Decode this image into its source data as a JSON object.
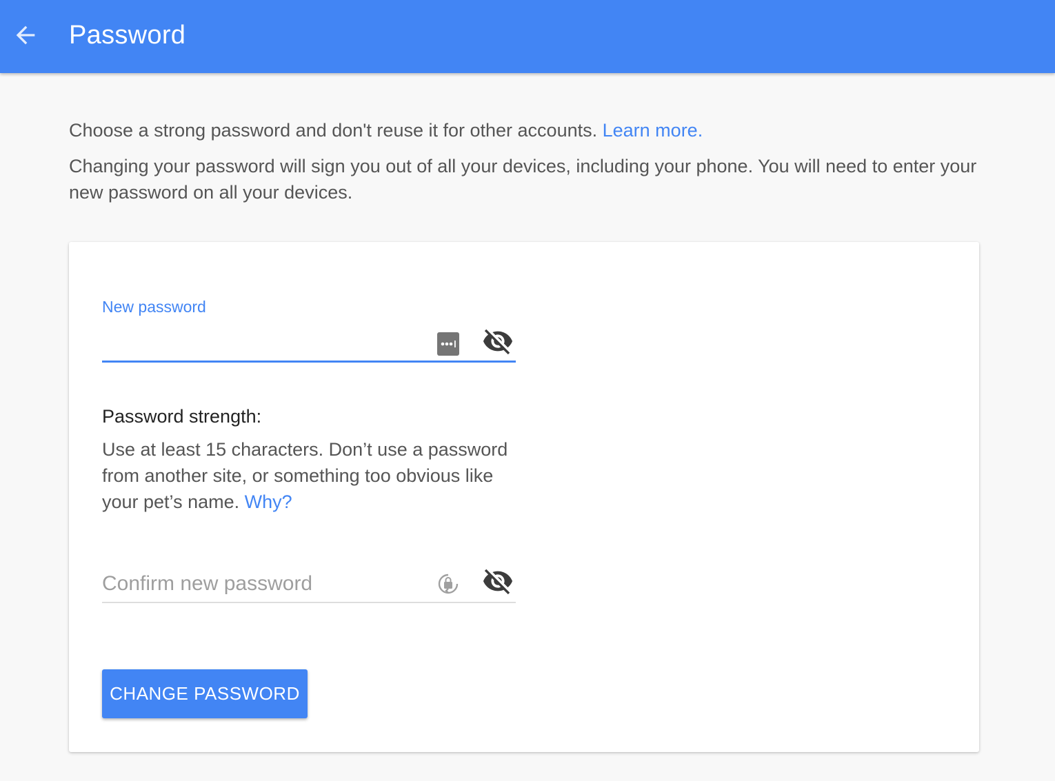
{
  "header": {
    "title": "Password",
    "back_icon": "arrow-back-icon"
  },
  "intro": {
    "line1": "Choose a strong password and don't reuse it for other accounts.",
    "learn_more": "Learn more.",
    "line2": "Changing your password will sign you out of all your devices, including your phone. You will need to enter your new password on all your devices."
  },
  "form": {
    "new_password": {
      "label": "New password",
      "value": "",
      "autofill_icon": "password-manager-icon",
      "visibility_icon": "visibility-off-icon"
    },
    "strength": {
      "label": "Password strength:",
      "help": "Use at least 15 characters. Don’t use a password from another site, or something too obvious like your pet’s name.",
      "why_link": "Why?"
    },
    "confirm_password": {
      "placeholder": "Confirm new password",
      "value": "",
      "autofill_icon": "password-sync-icon",
      "visibility_icon": "visibility-off-icon"
    },
    "submit_label": "CHANGE PASSWORD"
  },
  "colors": {
    "accent": "#4285f4",
    "background": "#f8f8f8",
    "card": "#ffffff",
    "text_primary": "#222222",
    "text_secondary": "#555555"
  }
}
